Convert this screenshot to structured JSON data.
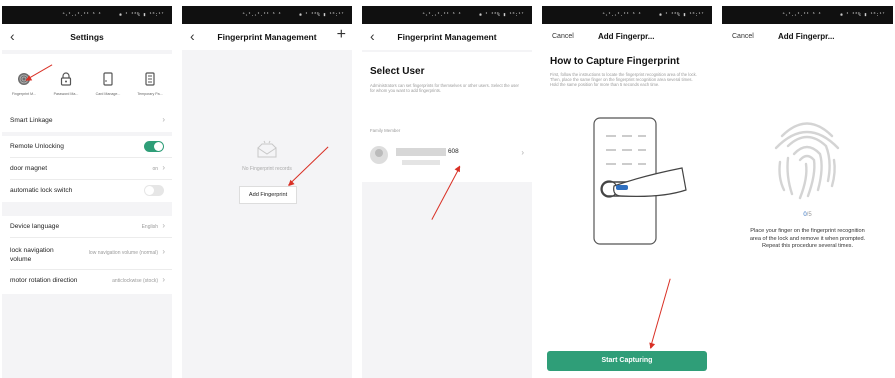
{
  "status": {
    "signal": "ᵃᵢᴵ.ᵢᴵ.ᴵᴵ ⁶ ⁴",
    "battery": "✱ ᴵ ²⁰% ▮ ¹⁰:¹⁷"
  },
  "settings": {
    "title": "Settings",
    "icons": [
      {
        "label": "Fingerprint M...",
        "icon": "fingerprint-icon"
      },
      {
        "label": "Password Ma...",
        "icon": "lock-icon"
      },
      {
        "label": "Card Manage...",
        "icon": "card-icon"
      },
      {
        "label": "Temporary Pa...",
        "icon": "keypad-icon"
      }
    ],
    "smart_linkage": "Smart Linkage",
    "remote_unlocking": "Remote Unlocking",
    "door_magnet": "door magnet",
    "door_magnet_value": "on",
    "auto_lock": "automatic lock switch",
    "device_language": "Device language",
    "device_language_value": "English",
    "lock_nav": "lock navigation volume",
    "lock_nav_value": "low navigation volume (normal)",
    "motor_dir": "motor rotation direction",
    "motor_dir_value": "anticlockwise (stock)"
  },
  "fp_mgmt": {
    "title": "Fingerprint Management",
    "empty": "No Fingerprint records",
    "add_button": "Add Fingerprint"
  },
  "select_user": {
    "title": "Fingerprint Management",
    "heading": "Select User",
    "desc": "Administrators can set fingerprints for themselves or other users. Select the user for whom you want to add fingerprints.",
    "family": "Family Member",
    "member_suffix": "608"
  },
  "how_to": {
    "cancel": "Cancel",
    "title": "Add Fingerpr...",
    "heading": "How to Capture Fingerprint",
    "desc": "First, follow the instructions to locate the fingerprint recognition area of the lock. Then, place the same finger on the fingerprint recognition area several times. Hold the same position for more than 5 seconds each time.",
    "start_button": "Start Capturing"
  },
  "capture": {
    "cancel": "Cancel",
    "title": "Add Fingerpr...",
    "progress_current": "0",
    "progress_total": "/5",
    "instruction": "Place your finger on the fingerprint recognition area of the lock and remove it when prompted. Repeat this procedure several times."
  }
}
